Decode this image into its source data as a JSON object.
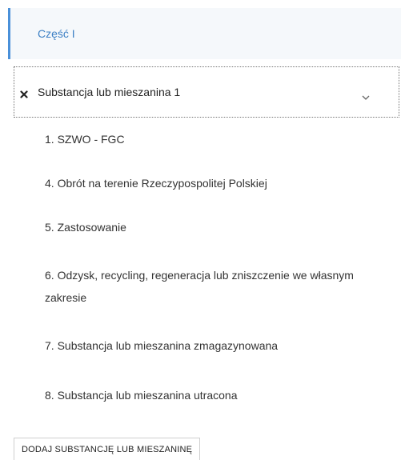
{
  "part": {
    "title": "Część I"
  },
  "substance": {
    "label": "Substancja lub mieszanina 1",
    "remove_icon": "close-icon",
    "expand_icon": "chevron-down-icon"
  },
  "sections": [
    "1. SZWO - FGC",
    "4. Obrót na terenie Rzeczypospolitej Polskiej",
    "5. Zastosowanie",
    "6. Odzysk, recycling, regeneracja lub zniszczenie we własnym zakresie",
    "7. Substancja lub mieszanina zmagazynowana",
    "8. Substancja lub mieszanina utracona"
  ],
  "actions": {
    "add_label": "DODAJ SUBSTANCJĘ LUB MIESZANINĘ"
  },
  "colors": {
    "accent": "#4a90d9",
    "link": "#3b7fc4",
    "header_bg": "#f5f8fb"
  }
}
